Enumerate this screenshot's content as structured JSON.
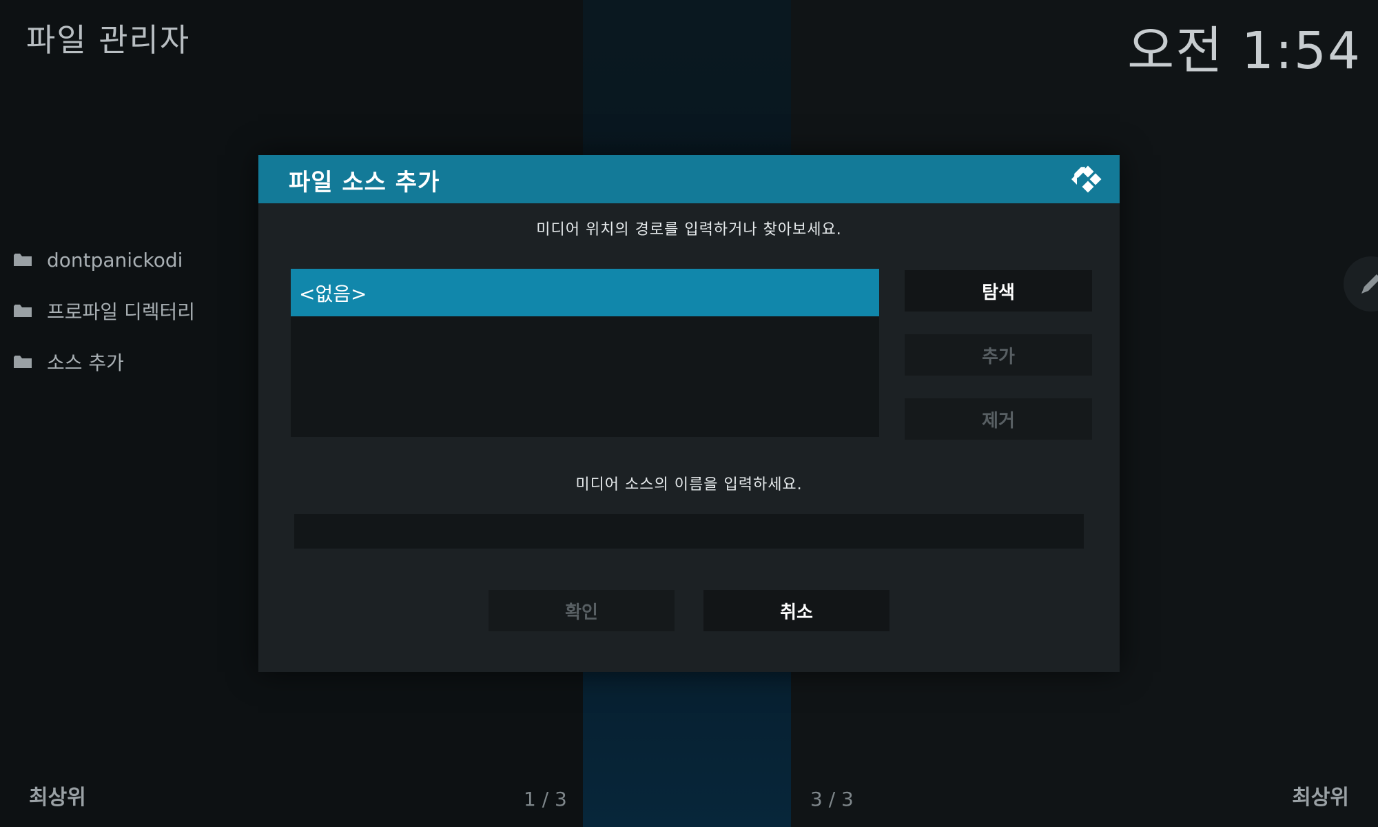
{
  "app": {
    "title": "파일 관리자",
    "clock": "오전 1:54"
  },
  "sidebar": {
    "items": [
      {
        "label": "dontpanickodi",
        "icon": "folder-icon"
      },
      {
        "label": "프로파일 디렉터리",
        "icon": "folder-icon"
      },
      {
        "label": "소스 추가",
        "icon": "folder-icon"
      }
    ]
  },
  "footer": {
    "left_label": "최상위",
    "right_label": "최상위",
    "page_left": "1 / 3",
    "page_right": "3 / 3"
  },
  "dialog": {
    "title": "파일 소스 추가",
    "path_prompt": "미디어 위치의 경로를 입력하거나 찾아보세요.",
    "path_items": [
      "<없음>"
    ],
    "browse_label": "탐색",
    "add_label": "추가",
    "remove_label": "제거",
    "name_prompt": "미디어 소스의 이름을 입력하세요.",
    "name_value": "",
    "ok_label": "확인",
    "cancel_label": "취소",
    "accent_color": "#137a98",
    "selected_color": "#1187ab"
  }
}
